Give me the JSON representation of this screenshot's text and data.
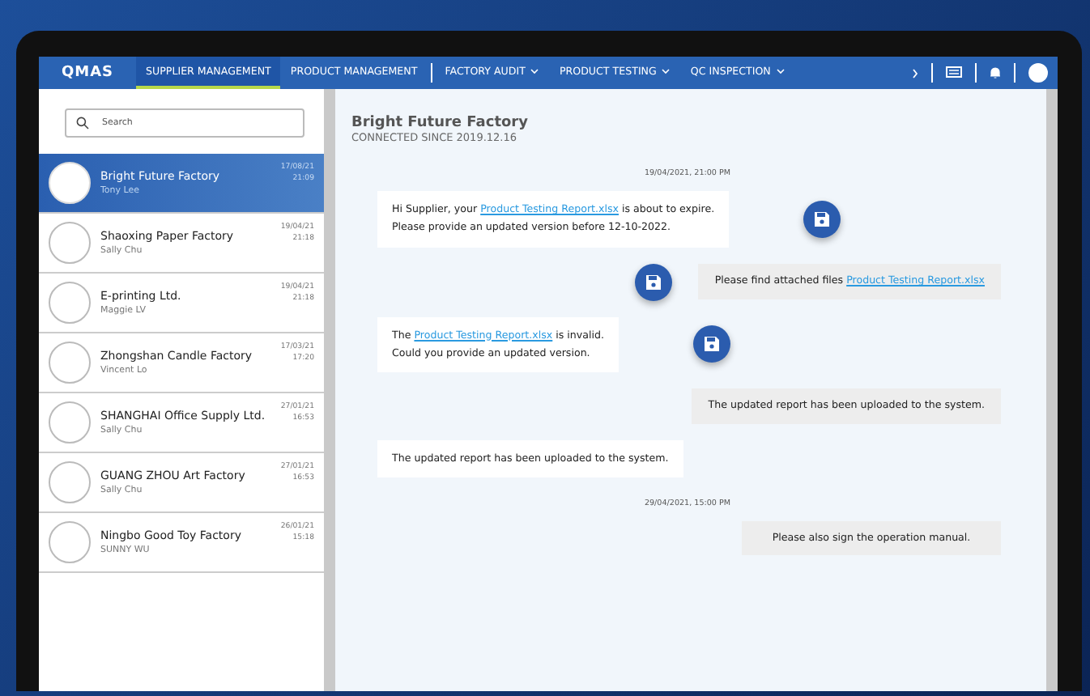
{
  "nav": {
    "logo": "QMAS",
    "tabs": [
      {
        "label": "SUPPLIER MANAGEMENT",
        "selected": true,
        "has_menu": false
      },
      {
        "label": "PRODUCT MANAGEMENT",
        "selected": false,
        "has_menu": false
      },
      {
        "label": "FACTORY AUDIT",
        "selected": false,
        "has_menu": true
      },
      {
        "label": "PRODUCT TESTING",
        "selected": false,
        "has_menu": true
      },
      {
        "label": "QC INSPECTION",
        "selected": false,
        "has_menu": true
      }
    ]
  },
  "sidebar": {
    "search": {
      "placeholder": "Search"
    },
    "items": [
      {
        "name": "Bright Future Factory",
        "contact": "Tony Lee",
        "date": "17/08/21",
        "time": "21:09",
        "selected": true
      },
      {
        "name": "Shaoxing Paper Factory",
        "contact": "Sally Chu",
        "date": "19/04/21",
        "time": "21:18",
        "selected": false
      },
      {
        "name": "E-printing Ltd.",
        "contact": "Maggie LV",
        "date": "19/04/21",
        "time": "21:18",
        "selected": false
      },
      {
        "name": "Zhongshan Candle Factory",
        "contact": "Vincent Lo",
        "date": "17/03/21",
        "time": "17:20",
        "selected": false
      },
      {
        "name": "SHANGHAI Office Supply Ltd.",
        "contact": "Sally Chu",
        "date": "27/01/21",
        "time": "16:53",
        "selected": false
      },
      {
        "name": "GUANG ZHOU Art Factory",
        "contact": "Sally Chu",
        "date": "27/01/21",
        "time": "16:53",
        "selected": false
      },
      {
        "name": "Ningbo Good Toy Factory",
        "contact": "SUNNY WU",
        "date": "26/01/21",
        "time": "15:18",
        "selected": false
      }
    ]
  },
  "chat": {
    "title": "Bright Future Factory",
    "subtitle": "CONNECTED SINCE 2019.12.16",
    "messages": [
      {
        "kind": "timestamp",
        "text": "19/04/2021, 21:00 PM"
      },
      {
        "kind": "incoming",
        "attachment": true,
        "parts": [
          {
            "kind": "text",
            "text": "Hi Supplier, your "
          },
          {
            "kind": "link",
            "text": "Product Testing Report.xlsx"
          },
          {
            "kind": "text",
            "text": " is about to expire.\nPlease provide an updated version before 12-10-2022."
          }
        ]
      },
      {
        "kind": "outgoing",
        "attachment": true,
        "parts": [
          {
            "kind": "text",
            "text": "Please find attached files "
          },
          {
            "kind": "link",
            "text": "Product Testing Report.xlsx"
          }
        ]
      },
      {
        "kind": "incoming",
        "attachment": true,
        "parts": [
          {
            "kind": "text",
            "text": "The "
          },
          {
            "kind": "link",
            "text": "Product Testing Report.xlsx"
          },
          {
            "kind": "text",
            "text": " is invalid.\nCould you provide an updated version."
          }
        ]
      },
      {
        "kind": "outgoing",
        "attachment": false,
        "parts": [
          {
            "kind": "text",
            "text": "The updated report has been uploaded to the system."
          }
        ]
      },
      {
        "kind": "incoming",
        "attachment": false,
        "parts": [
          {
            "kind": "text",
            "text": "The updated report has been uploaded to the system."
          }
        ]
      },
      {
        "kind": "timestamp",
        "text": "29/04/2021, 15:00 PM"
      },
      {
        "kind": "outgoing",
        "attachment": false,
        "parts": [
          {
            "kind": "text",
            "text": "Please also sign the operation manual."
          }
        ]
      }
    ]
  }
}
